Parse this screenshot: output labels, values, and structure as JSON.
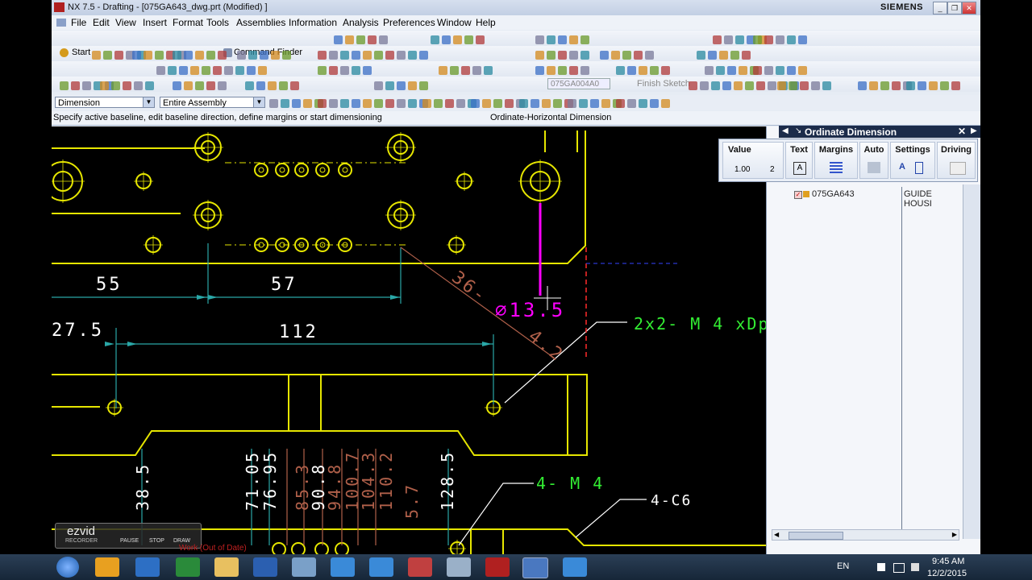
{
  "window": {
    "title": "NX 7.5 - Drafting - [075GA643_dwg.prt (Modified) ]",
    "brand": "SIEMENS"
  },
  "menu": [
    "File",
    "Edit",
    "View",
    "Insert",
    "Format",
    "Tools",
    "Assemblies",
    "Information",
    "Analysis",
    "Preferences",
    "Window",
    "Help"
  ],
  "toolbar": {
    "start_label": "Start",
    "command_finder": "Command Finder",
    "sketch_name": "075GA004A0",
    "finish_sketch": "Finish Sketch"
  },
  "selection": {
    "filter": "Dimension",
    "scope": "Entire Assembly"
  },
  "cue": {
    "prompt": "Specify active baseline, edit baseline direction, define margins or start dimensioning",
    "status": "Ordinate-Horizontal Dimension"
  },
  "ordinate_dialog": {
    "title": "Ordinate Dimension",
    "groups": {
      "value": "Value",
      "text": "Text",
      "margins": "Margins",
      "auto": "Auto",
      "settings": "Settings",
      "driving": "Driving"
    },
    "tolerance_value": "1.00",
    "precision": "2"
  },
  "nav_row": {
    "part": "075GA643",
    "description": "GUIDE HOUSI"
  },
  "drawing": {
    "dims": {
      "d55": "55",
      "d57": "57",
      "d36": "36-",
      "d13_5": "⌀13.5",
      "d4_2": "4.2",
      "d27_5": "27.5",
      "d112": "112",
      "d38_5": "38.5",
      "d71_05": "71.05",
      "d76_95": "76.95",
      "d85_3": "85.3",
      "d90_8": "90.8",
      "d94_8": "94.8",
      "d100_7": "100.7",
      "d104_3": "104.3",
      "d110_2": "110.2",
      "d5_7": "5.7",
      "d128_5": "128.5"
    },
    "notes": {
      "tap_2x2": "2x2- M 4 xDp",
      "tap_4": "4- M 4",
      "chamfer": "4-C6"
    },
    "status_overlay": "Work (Out of Date)"
  },
  "recorder": {
    "brand": "ezvid",
    "sub": "RECORDER",
    "pause": "PAUSE",
    "stop": "STOP",
    "draw": "DRAW"
  },
  "tray": {
    "lang": "EN",
    "time": "9:45 AM",
    "date": "12/2/2015"
  },
  "colors": {
    "geometry": "#e6e600",
    "dimension_text": "#ffffff",
    "leader": "#2aa7a7",
    "active_dim": "#ff00ff",
    "note_green": "#33ee33",
    "red_dim": "#c05050"
  }
}
